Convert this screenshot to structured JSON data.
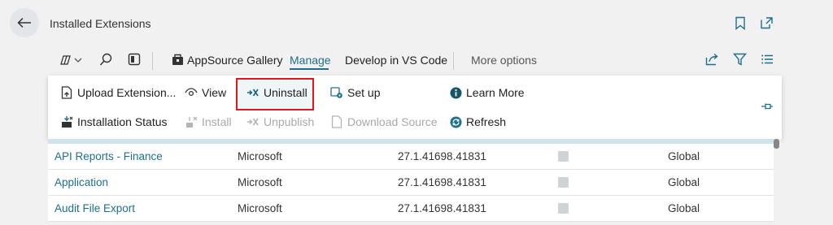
{
  "header": {
    "title": "Installed Extensions"
  },
  "actionbar": {
    "appsource": "AppSource Gallery",
    "manage": "Manage",
    "develop": "Develop in VS Code",
    "more": "More options"
  },
  "manage_menu": {
    "upload": "Upload Extension...",
    "view": "View",
    "uninstall": "Uninstall",
    "setup": "Set up",
    "learn_more": "Learn More",
    "installation_status": "Installation Status",
    "install": "Install",
    "unpublish": "Unpublish",
    "download_source": "Download Source",
    "refresh": "Refresh"
  },
  "rows": [
    {
      "name": "API Reports - Finance",
      "publisher": "Microsoft",
      "version": "27.1.41698.41831",
      "installed": true,
      "scope": "Global"
    },
    {
      "name": "Application",
      "publisher": "Microsoft",
      "version": "27.1.41698.41831",
      "installed": true,
      "scope": "Global"
    },
    {
      "name": "Audit File Export",
      "publisher": "Microsoft",
      "version": "27.1.41698.41831",
      "installed": true,
      "scope": "Global"
    }
  ],
  "colors": {
    "accent": "#1f6f8b",
    "highlight_border": "#e6151b",
    "info_icon": "#16566b"
  }
}
